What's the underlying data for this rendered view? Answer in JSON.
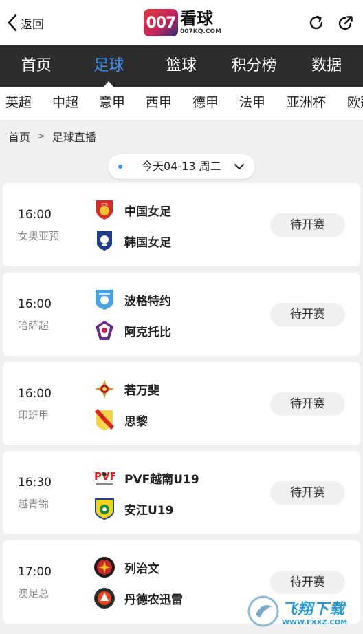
{
  "header": {
    "back_label": "返回",
    "logo_mark": "007",
    "logo_name": "看球",
    "logo_domain": "007KQ.COM"
  },
  "nav": [
    {
      "label": "首页",
      "active": false
    },
    {
      "label": "足球",
      "active": true
    },
    {
      "label": "篮球",
      "active": false
    },
    {
      "label": "积分榜",
      "active": false
    },
    {
      "label": "数据",
      "active": false
    }
  ],
  "leagues": [
    "英超",
    "中超",
    "意甲",
    "西甲",
    "德甲",
    "法甲",
    "亚洲杯",
    "欧冠"
  ],
  "breadcrumb": {
    "home": "首页",
    "separator": ">",
    "current": "足球直播"
  },
  "date_selector": {
    "label": "今天04-13 周二"
  },
  "matches": [
    {
      "time": "16:00",
      "league": "女奥亚预",
      "home": "中国女足",
      "away": "韩国女足",
      "status": "待开赛"
    },
    {
      "time": "16:00",
      "league": "哈萨超",
      "home": "波格特约",
      "away": "阿克托比",
      "status": "待开赛"
    },
    {
      "time": "16:00",
      "league": "印班甲",
      "home": "若万斐",
      "away": "思黎",
      "status": "待开赛"
    },
    {
      "time": "16:30",
      "league": "越青锦",
      "home": "PVF越南U19",
      "away": "安江U19",
      "status": "待开赛"
    },
    {
      "time": "17:00",
      "league": "澳足总",
      "home": "列治文",
      "away": "丹德农迅雷",
      "status": "待开赛"
    }
  ],
  "watermark": {
    "name": "飞翔下载",
    "url": "WWW.FXXZ.COM"
  },
  "colors": {
    "accent": "#3b8ff0",
    "navbar_bg": "#2d2d2d",
    "page_bg": "#f0f0f0"
  }
}
